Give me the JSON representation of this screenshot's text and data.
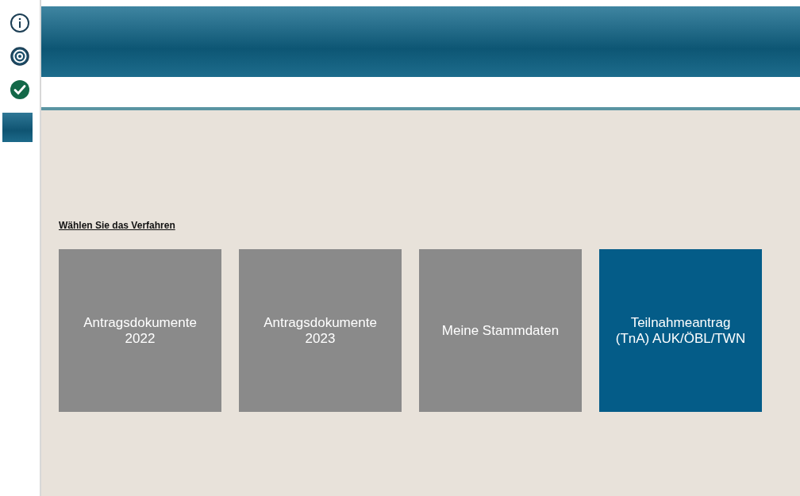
{
  "sidebar": {
    "icons": [
      {
        "kind": "info"
      },
      {
        "kind": "email"
      },
      {
        "kind": "check"
      }
    ],
    "active_block": true
  },
  "section_title": "Wählen Sie das Verfahren",
  "tiles": [
    {
      "label": "Antragsdokumente\n2022",
      "selected": false
    },
    {
      "label": "Antragsdokumente\n2023",
      "selected": false
    },
    {
      "label": "Meine Stammdaten",
      "selected": false
    },
    {
      "label": "Teilnahmeantrag\n(TnA) AUK/ÖBL/TWN",
      "selected": true
    }
  ]
}
